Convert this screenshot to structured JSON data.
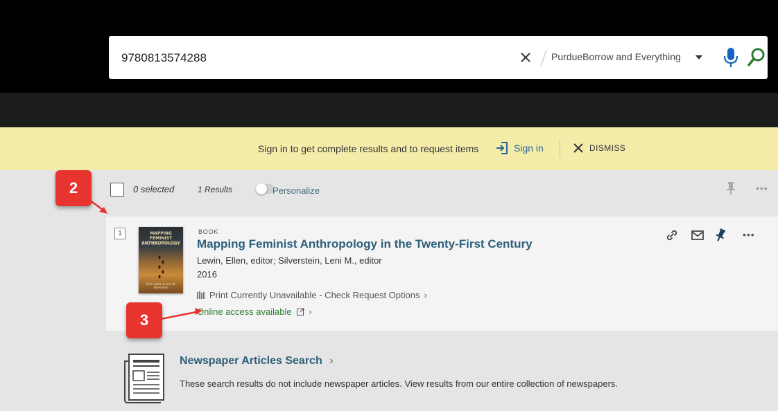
{
  "search": {
    "query": "9780813574288",
    "scope": "PurdueBorrow and Everything"
  },
  "signin_banner": {
    "message": "Sign in to get complete results and to request items",
    "signin_label": "Sign in",
    "dismiss_label": "DISMISS"
  },
  "results_bar": {
    "selected": "0 selected",
    "results": "1 Results",
    "personalize": "Personalize"
  },
  "result": {
    "number": "1",
    "type": "BOOK",
    "title": "Mapping Feminist Anthropology in the Twenty-First Century",
    "authors": "Lewin, Ellen, editor; Silverstein, Leni M., editor",
    "year": "2016",
    "print_status": "Print Currently Unavailable - Check Request Options",
    "online_status": "Online access available",
    "cover": {
      "title": "MAPPING FEMINIST ANTHROPOLOGY",
      "subtitle": "in the Twenty-First Century",
      "editors": "Ellen Lewin & Leni M. Silverstein"
    }
  },
  "newspaper": {
    "title": "Newspaper Articles Search",
    "description": "These search results do not include newspaper articles. View results from our entire collection of newspapers."
  },
  "callouts": {
    "first": "2",
    "second": "3"
  },
  "colors": {
    "accent_link": "#2d5f7a",
    "online_green": "#2e7d32",
    "banner_yellow": "#f5ecaa",
    "callout_red": "#e8342f"
  }
}
